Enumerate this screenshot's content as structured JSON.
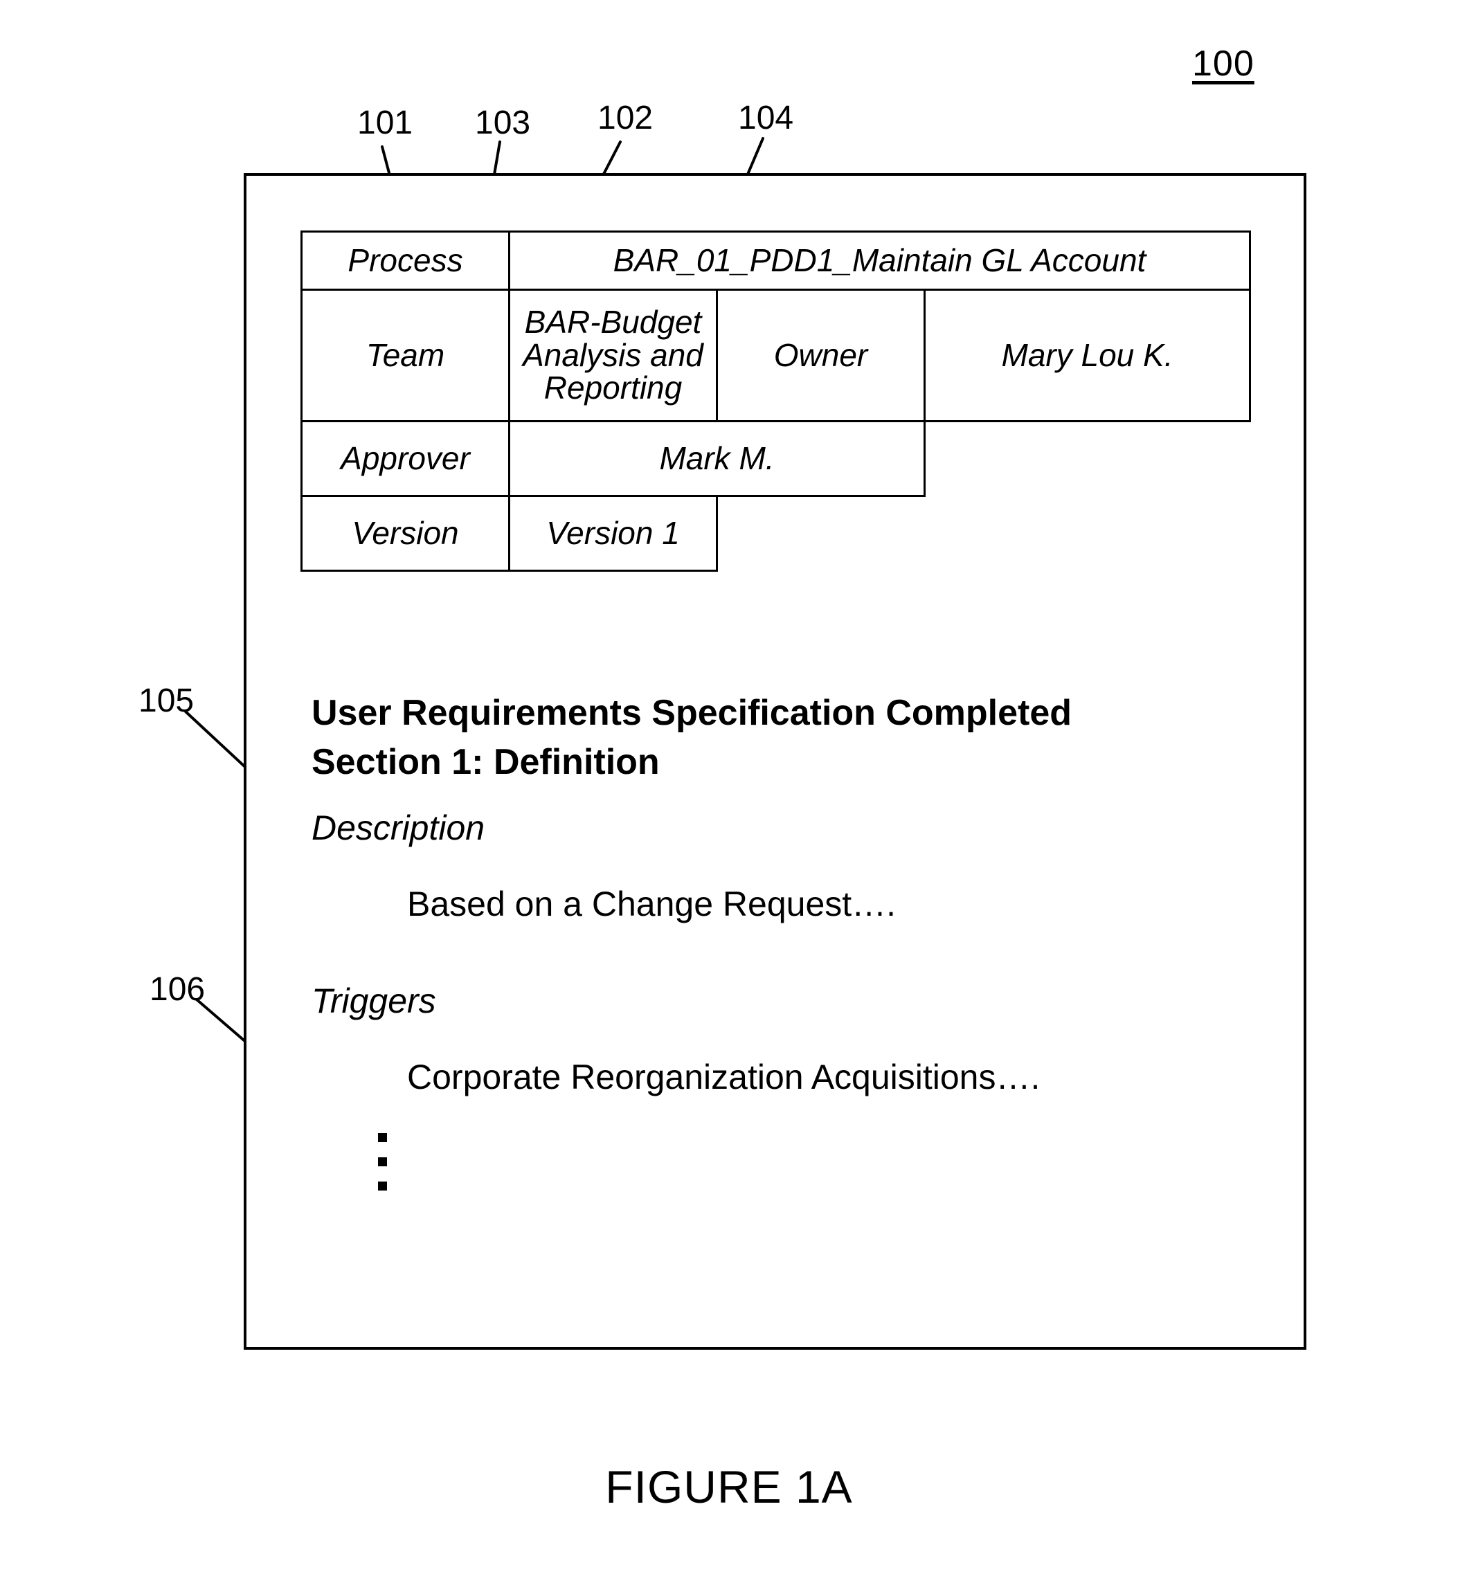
{
  "figure": {
    "number_label": "100",
    "caption": "FIGURE 1A"
  },
  "reference_numerals": {
    "n101": "101",
    "n103": "103",
    "n102": "102",
    "n104": "104",
    "n105": "105",
    "n106": "106"
  },
  "meta_table": {
    "rows": [
      {
        "label": "Process",
        "value": "BAR_01_PDD1_Maintain GL Account"
      },
      {
        "label": "Team",
        "value": "BAR-Budget Analysis and Reporting",
        "label2": "Owner",
        "value2": "Mary Lou K."
      },
      {
        "label": "Approver",
        "value": "Mark M."
      },
      {
        "label": "Version",
        "value": "Version 1"
      }
    ]
  },
  "document_body": {
    "heading": "User Requirements Specification Completed",
    "subheading": "Section 1: Definition",
    "description_label": "Description",
    "description_text": "Based on a Change Request….",
    "triggers_label": "Triggers",
    "triggers_text": "Corporate Reorganization Acquisitions….",
    "continuation": "⋮"
  }
}
